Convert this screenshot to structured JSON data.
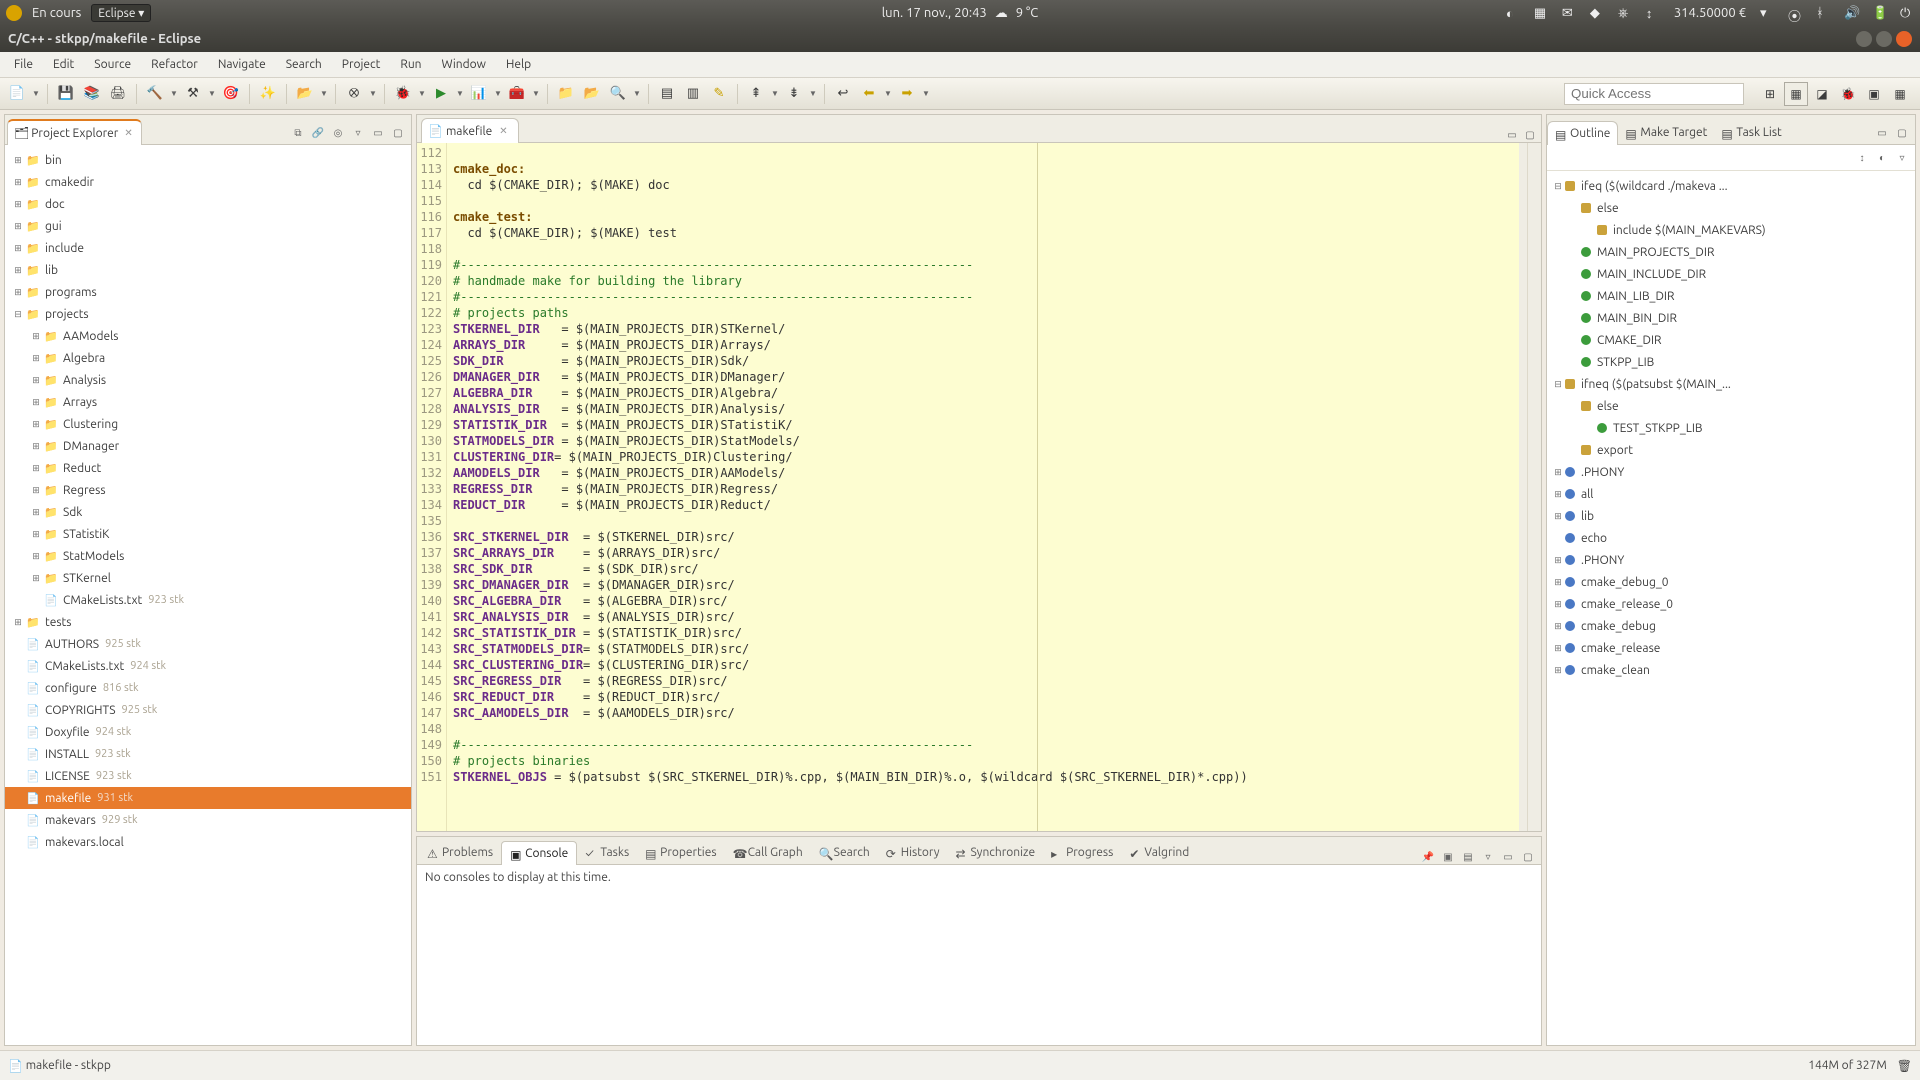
{
  "system_panel": {
    "app_menu": "En cours",
    "eclipse_label": "Eclipse ▾",
    "datetime": "lun. 17 nov., 20:43",
    "weather": "9 °C",
    "balance": "314.50000 €"
  },
  "window": {
    "title": "C/C++ - stkpp/makefile - Eclipse"
  },
  "menu": {
    "items": [
      "File",
      "Edit",
      "Source",
      "Refactor",
      "Navigate",
      "Search",
      "Project",
      "Run",
      "Window",
      "Help"
    ]
  },
  "quick_access": {
    "placeholder": "Quick Access"
  },
  "project_explorer": {
    "title": "Project Explorer",
    "tree": [
      {
        "depth": 0,
        "tw": "⊞",
        "icon": "fold",
        "label": "bin"
      },
      {
        "depth": 0,
        "tw": "⊞",
        "icon": "fold",
        "label": "cmakedir"
      },
      {
        "depth": 0,
        "tw": "⊞",
        "icon": "fold",
        "label": "doc"
      },
      {
        "depth": 0,
        "tw": "⊞",
        "icon": "fold",
        "label": "gui"
      },
      {
        "depth": 0,
        "tw": "⊞",
        "icon": "fold",
        "label": "include"
      },
      {
        "depth": 0,
        "tw": "⊞",
        "icon": "fold",
        "label": "lib"
      },
      {
        "depth": 0,
        "tw": "⊞",
        "icon": "fold",
        "label": "programs"
      },
      {
        "depth": 0,
        "tw": "⊟",
        "icon": "fold",
        "label": "projects"
      },
      {
        "depth": 1,
        "tw": "⊞",
        "icon": "fold",
        "label": "AAModels"
      },
      {
        "depth": 1,
        "tw": "⊞",
        "icon": "fold",
        "label": "Algebra"
      },
      {
        "depth": 1,
        "tw": "⊞",
        "icon": "fold",
        "label": "Analysis"
      },
      {
        "depth": 1,
        "tw": "⊞",
        "icon": "fold",
        "label": "Arrays"
      },
      {
        "depth": 1,
        "tw": "⊞",
        "icon": "fold",
        "label": "Clustering"
      },
      {
        "depth": 1,
        "tw": "⊞",
        "icon": "fold",
        "label": "DManager"
      },
      {
        "depth": 1,
        "tw": "⊞",
        "icon": "fold",
        "label": "Reduct"
      },
      {
        "depth": 1,
        "tw": "⊞",
        "icon": "fold",
        "label": "Regress"
      },
      {
        "depth": 1,
        "tw": "⊞",
        "icon": "fold",
        "label": "Sdk"
      },
      {
        "depth": 1,
        "tw": "⊞",
        "icon": "fold",
        "label": "STatistiK"
      },
      {
        "depth": 1,
        "tw": "⊞",
        "icon": "fold",
        "label": "StatModels"
      },
      {
        "depth": 1,
        "tw": "⊞",
        "icon": "fold",
        "label": "STKernel"
      },
      {
        "depth": 1,
        "tw": "",
        "icon": "file",
        "label": "CMakeLists.txt",
        "rev": "923  stk"
      },
      {
        "depth": 0,
        "tw": "⊞",
        "icon": "fold",
        "label": "tests"
      },
      {
        "depth": 0,
        "tw": "",
        "icon": "file",
        "label": "AUTHORS",
        "rev": "925  stk"
      },
      {
        "depth": 0,
        "tw": "",
        "icon": "file",
        "label": "CMakeLists.txt",
        "rev": "924  stk"
      },
      {
        "depth": 0,
        "tw": "",
        "icon": "file",
        "label": "configure",
        "rev": "816  stk"
      },
      {
        "depth": 0,
        "tw": "",
        "icon": "file",
        "label": "COPYRIGHTS",
        "rev": "925  stk"
      },
      {
        "depth": 0,
        "tw": "",
        "icon": "file",
        "label": "Doxyfile",
        "rev": "924  stk"
      },
      {
        "depth": 0,
        "tw": "",
        "icon": "file",
        "label": "INSTALL",
        "rev": "923  stk"
      },
      {
        "depth": 0,
        "tw": "",
        "icon": "file",
        "label": "LICENSE",
        "rev": "923  stk"
      },
      {
        "depth": 0,
        "tw": "",
        "icon": "file",
        "label": "makefile",
        "rev": "931  stk",
        "selected": true
      },
      {
        "depth": 0,
        "tw": "",
        "icon": "file",
        "label": "makevars",
        "rev": "929  stk"
      },
      {
        "depth": 0,
        "tw": "",
        "icon": "file",
        "label": "makevars.local"
      }
    ]
  },
  "editor": {
    "tab": "makefile",
    "first_line": 112,
    "lines": [
      {
        "t": ""
      },
      {
        "t": "cmake_doc:",
        "cls": "key"
      },
      {
        "t": "  cd $(CMAKE_DIR); $(MAKE) doc"
      },
      {
        "t": ""
      },
      {
        "t": "cmake_test:",
        "cls": "key"
      },
      {
        "t": "  cd $(CMAKE_DIR); $(MAKE) test"
      },
      {
        "t": ""
      },
      {
        "t": "#-----------------------------------------------------------------------",
        "cls": "cmt"
      },
      {
        "t": "# handmade make for building the library",
        "cls": "cmt"
      },
      {
        "t": "#-----------------------------------------------------------------------",
        "cls": "cmt"
      },
      {
        "t": "# projects paths",
        "cls": "cmt"
      },
      {
        "v": "STKERNEL_DIR",
        "rest": "   = $(MAIN_PROJECTS_DIR)STKernel/"
      },
      {
        "v": "ARRAYS_DIR",
        "rest": "     = $(MAIN_PROJECTS_DIR)Arrays/"
      },
      {
        "v": "SDK_DIR",
        "rest": "        = $(MAIN_PROJECTS_DIR)Sdk/"
      },
      {
        "v": "DMANAGER_DIR",
        "rest": "   = $(MAIN_PROJECTS_DIR)DManager/"
      },
      {
        "v": "ALGEBRA_DIR",
        "rest": "    = $(MAIN_PROJECTS_DIR)Algebra/"
      },
      {
        "v": "ANALYSIS_DIR",
        "rest": "   = $(MAIN_PROJECTS_DIR)Analysis/"
      },
      {
        "v": "STATISTIK_DIR",
        "rest": "  = $(MAIN_PROJECTS_DIR)STatistiK/"
      },
      {
        "v": "STATMODELS_DIR",
        "rest": " = $(MAIN_PROJECTS_DIR)StatModels/"
      },
      {
        "v": "CLUSTERING_DIR",
        "rest": "= $(MAIN_PROJECTS_DIR)Clustering/"
      },
      {
        "v": "AAMODELS_DIR",
        "rest": "   = $(MAIN_PROJECTS_DIR)AAModels/"
      },
      {
        "v": "REGRESS_DIR",
        "rest": "    = $(MAIN_PROJECTS_DIR)Regress/"
      },
      {
        "v": "REDUCT_DIR",
        "rest": "     = $(MAIN_PROJECTS_DIR)Reduct/"
      },
      {
        "t": ""
      },
      {
        "v": "SRC_STKERNEL_DIR",
        "rest": "  = $(STKERNEL_DIR)src/"
      },
      {
        "v": "SRC_ARRAYS_DIR",
        "rest": "    = $(ARRAYS_DIR)src/"
      },
      {
        "v": "SRC_SDK_DIR",
        "rest": "       = $(SDK_DIR)src/"
      },
      {
        "v": "SRC_DMANAGER_DIR",
        "rest": "  = $(DMANAGER_DIR)src/"
      },
      {
        "v": "SRC_ALGEBRA_DIR",
        "rest": "   = $(ALGEBRA_DIR)src/"
      },
      {
        "v": "SRC_ANALYSIS_DIR",
        "rest": "  = $(ANALYSIS_DIR)src/"
      },
      {
        "v": "SRC_STATISTIK_DIR",
        "rest": " = $(STATISTIK_DIR)src/"
      },
      {
        "v": "SRC_STATMODELS_DIR",
        "rest": "= $(STATMODELS_DIR)src/"
      },
      {
        "v": "SRC_CLUSTERING_DIR",
        "rest": "= $(CLUSTERING_DIR)src/"
      },
      {
        "v": "SRC_REGRESS_DIR",
        "rest": "   = $(REGRESS_DIR)src/"
      },
      {
        "v": "SRC_REDUCT_DIR",
        "rest": "    = $(REDUCT_DIR)src/"
      },
      {
        "v": "SRC_AAMODELS_DIR",
        "rest": "  = $(AAMODELS_DIR)src/"
      },
      {
        "t": ""
      },
      {
        "t": "#-----------------------------------------------------------------------",
        "cls": "cmt"
      },
      {
        "t": "# projects binaries",
        "cls": "cmt"
      },
      {
        "v": "STKERNEL_OBJS",
        "rest": " = $(patsubst $(SRC_STKERNEL_DIR)%.cpp, $(MAIN_BIN_DIR)%.o, $(wildcard $(SRC_STKERNEL_DIR)*.cpp))"
      }
    ]
  },
  "dock": {
    "tabs": [
      "Problems",
      "Console",
      "Tasks",
      "Properties",
      "Call Graph",
      "Search",
      "History",
      "Synchronize",
      "Progress",
      "Valgrind"
    ],
    "active": 1,
    "message": "No consoles to display at this time."
  },
  "outline": {
    "tabs": [
      "Outline",
      "Make Target",
      "Task List"
    ],
    "items": [
      {
        "depth": 0,
        "tw": "⊟",
        "dot": "doc",
        "label": "ifeq ($(wildcard ./makeva ..."
      },
      {
        "depth": 1,
        "tw": "",
        "dot": "doc",
        "label": "else"
      },
      {
        "depth": 2,
        "tw": "",
        "dot": "doc",
        "label": "include $(MAIN_MAKEVARS)"
      },
      {
        "depth": 1,
        "tw": "",
        "dot": "g",
        "label": "MAIN_PROJECTS_DIR"
      },
      {
        "depth": 1,
        "tw": "",
        "dot": "g",
        "label": "MAIN_INCLUDE_DIR"
      },
      {
        "depth": 1,
        "tw": "",
        "dot": "g",
        "label": "MAIN_LIB_DIR"
      },
      {
        "depth": 1,
        "tw": "",
        "dot": "g",
        "label": "MAIN_BIN_DIR"
      },
      {
        "depth": 1,
        "tw": "",
        "dot": "g",
        "label": "CMAKE_DIR"
      },
      {
        "depth": 1,
        "tw": "",
        "dot": "g",
        "label": "STKPP_LIB"
      },
      {
        "depth": 0,
        "tw": "⊟",
        "dot": "doc",
        "label": "ifneq ($(patsubst $(MAIN_..."
      },
      {
        "depth": 1,
        "tw": "",
        "dot": "doc",
        "label": "else"
      },
      {
        "depth": 2,
        "tw": "",
        "dot": "g",
        "label": "TEST_STKPP_LIB"
      },
      {
        "depth": 1,
        "tw": "",
        "dot": "doc",
        "label": "export"
      },
      {
        "depth": 0,
        "tw": "⊞",
        "dot": "b",
        "label": ".PHONY"
      },
      {
        "depth": 0,
        "tw": "⊞",
        "dot": "b",
        "label": "all"
      },
      {
        "depth": 0,
        "tw": "⊞",
        "dot": "b",
        "label": "lib"
      },
      {
        "depth": 0,
        "tw": "",
        "dot": "b",
        "label": "echo"
      },
      {
        "depth": 0,
        "tw": "⊞",
        "dot": "b",
        "label": ".PHONY"
      },
      {
        "depth": 0,
        "tw": "⊞",
        "dot": "b",
        "label": "cmake_debug_0"
      },
      {
        "depth": 0,
        "tw": "⊞",
        "dot": "b",
        "label": "cmake_release_0"
      },
      {
        "depth": 0,
        "tw": "⊞",
        "dot": "b",
        "label": "cmake_debug"
      },
      {
        "depth": 0,
        "tw": "⊞",
        "dot": "b",
        "label": "cmake_release"
      },
      {
        "depth": 0,
        "tw": "⊞",
        "dot": "b",
        "label": "cmake_clean"
      }
    ]
  },
  "status": {
    "left": "makefile - stkpp",
    "heap": "144M of 327M"
  }
}
